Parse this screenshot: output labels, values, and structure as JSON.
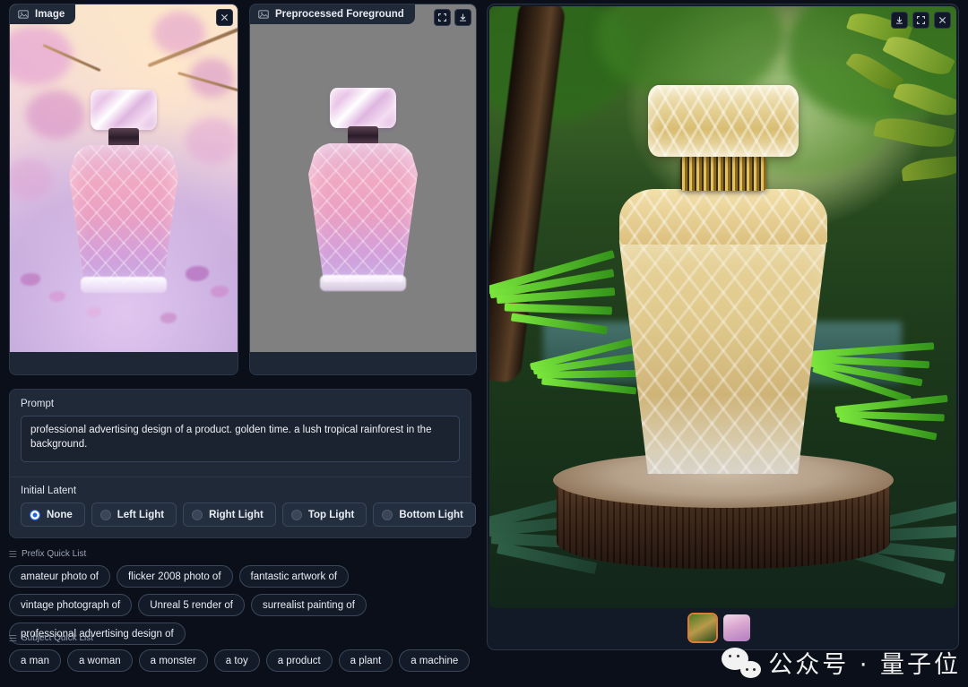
{
  "app": {
    "background_color": "#0b0f19",
    "panel_color": "#1f2937",
    "accent_color": "#2563eb"
  },
  "left_panel": {
    "source_image_card": {
      "title": "Image",
      "icon": "image-icon",
      "close_label": "×",
      "image_description": "pink crystal perfume bottle with cherry blossom branches"
    },
    "preprocessed_card": {
      "title": "Preprocessed Foreground",
      "icon": "image-icon",
      "fullscreen_label": "fullscreen-icon",
      "download_label": "download-icon",
      "image_description": "isolated pink perfume bottle on grey background",
      "background_color": "#808080"
    }
  },
  "prompt_section": {
    "label": "Prompt",
    "value": "professional advertising design of a product. golden time. a lush tropical rainforest in the background.",
    "placeholder": "Prompt"
  },
  "initial_latent": {
    "label": "Initial Latent",
    "selected": "None",
    "options": [
      {
        "label": "None",
        "selected": true
      },
      {
        "label": "Left Light",
        "selected": false
      },
      {
        "label": "Right Light",
        "selected": false
      },
      {
        "label": "Top Light",
        "selected": false
      },
      {
        "label": "Bottom Light",
        "selected": false
      }
    ]
  },
  "prefix_quick_list": {
    "label": "Prefix Quick List",
    "icon": "list-icon",
    "items": [
      "amateur photo of",
      "flicker 2008 photo of",
      "fantastic artwork of",
      "vintage photograph of",
      "Unreal 5 render of",
      "surrealist painting of",
      "professional advertising design of"
    ]
  },
  "subject_quick_list": {
    "label": "Subject Quick List",
    "icon": "list-icon",
    "items": [
      "a man",
      "a woman",
      "a monster",
      "a toy",
      "a product",
      "a plant",
      "a machine"
    ]
  },
  "result_panel": {
    "image_description": "golden crystal perfume bottle on a tree stump in a sunlit tropical rainforest",
    "tools": [
      {
        "name": "download-icon",
        "label": "Download"
      },
      {
        "name": "fullscreen-icon",
        "label": "Fullscreen"
      },
      {
        "name": "close-icon",
        "label": "Close"
      }
    ],
    "gallery": [
      {
        "name": "thumb-forest-result",
        "selected": true
      },
      {
        "name": "thumb-pink-bottle",
        "selected": false
      }
    ]
  },
  "watermark": {
    "text": "公众号 · 量子位",
    "logo": "wechat-logo"
  }
}
